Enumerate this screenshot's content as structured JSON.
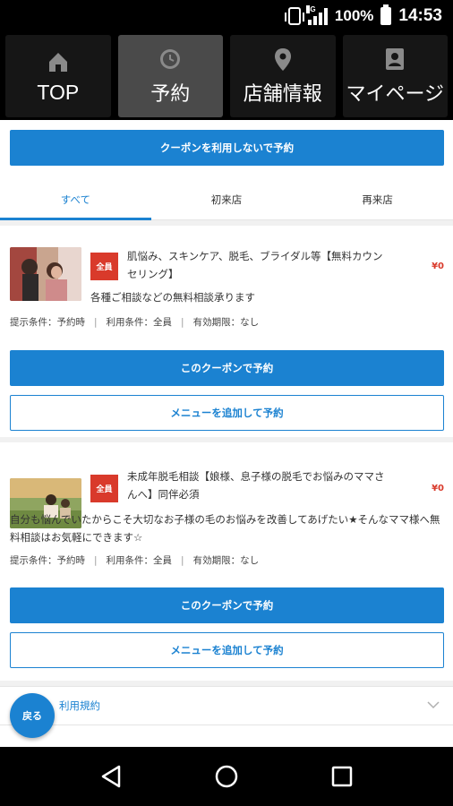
{
  "statusbar": {
    "network": "4G",
    "battery": "100%",
    "time": "14:53"
  },
  "topnav": [
    {
      "label": "TOP",
      "icon": "home-icon"
    },
    {
      "label": "予約",
      "icon": "clock-icon"
    },
    {
      "label": "店舗情報",
      "icon": "location-pin-icon"
    },
    {
      "label": "マイページ",
      "icon": "user-card-icon"
    }
  ],
  "actions": {
    "no_coupon_label": "クーポンを利用しないで予約"
  },
  "tabs": [
    {
      "label": "すべて",
      "active": true
    },
    {
      "label": "初来店",
      "active": false
    },
    {
      "label": "再来店",
      "active": false
    }
  ],
  "coupons": [
    {
      "badge": "全員",
      "title": "肌悩み、スキンケア、脱毛、ブライダル等【無料カウンセリング】",
      "price": "¥0",
      "description": "各種ご相談などの無料相談承ります",
      "conditions": [
        "提示条件：予約時",
        "利用条件：全員",
        "有効期限：なし"
      ],
      "reserve_label": "このクーポンで予約",
      "add_menu_label": "メニューを追加して予約"
    },
    {
      "badge": "全員",
      "title": "未成年脱毛相談【娘様、息子様の脱毛でお悩みのママさんへ】同伴必須",
      "price": "¥0",
      "description": "自分も悩んでいたからこそ大切なお子様の毛のお悩みを改善してあげたい★そんなママ様へ無料相談はお気軽にできます☆",
      "conditions": [
        "提示条件：予約時",
        "利用条件：全員",
        "有効期限：なし"
      ],
      "reserve_label": "このクーポンで予約",
      "add_menu_label": "メニューを追加して予約"
    }
  ],
  "footer": {
    "terms_label": "利用規約",
    "back_label": "戻る"
  },
  "colors": {
    "accent": "#1b82d1",
    "badge": "#d93a2b",
    "price": "#d93a2b"
  }
}
